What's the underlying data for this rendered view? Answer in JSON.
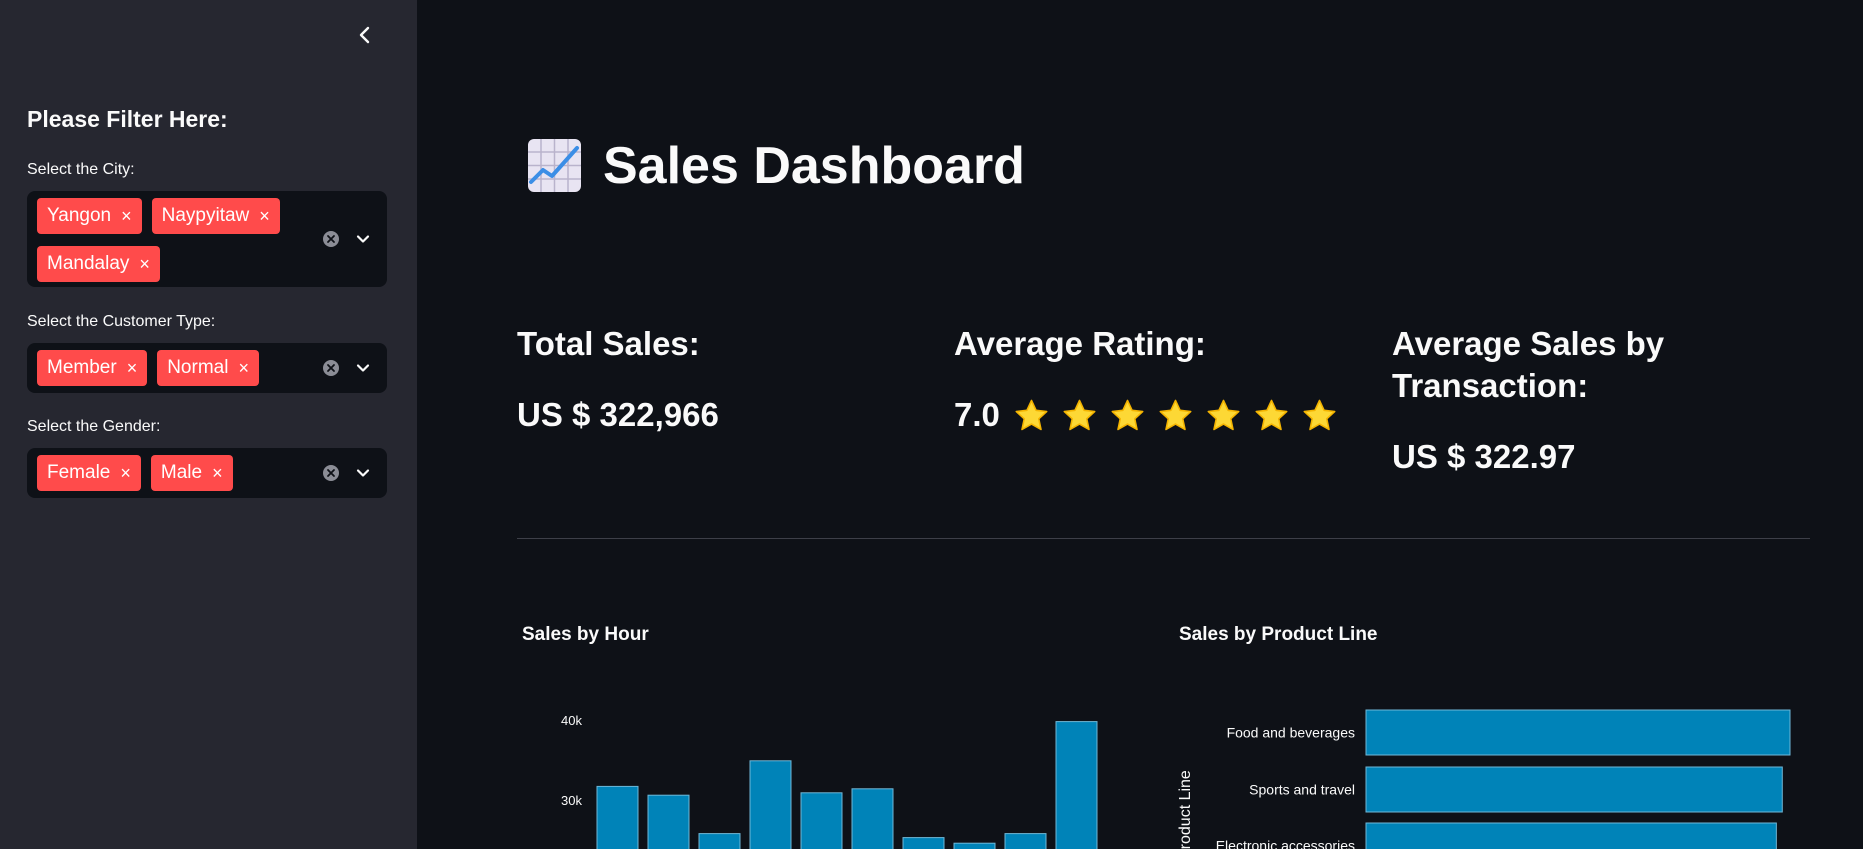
{
  "sidebar": {
    "header": "Please Filter Here:",
    "filters": [
      {
        "label": "Select the City:",
        "chips": [
          "Yangon",
          "Naypyitaw",
          "Mandalay"
        ]
      },
      {
        "label": "Select the Customer Type:",
        "chips": [
          "Member",
          "Normal"
        ]
      },
      {
        "label": "Select the Gender:",
        "chips": [
          "Female",
          "Male"
        ]
      }
    ],
    "chip_remove_glyph": "×"
  },
  "main": {
    "title": "Sales Dashboard",
    "title_icon": "chart-increasing-icon",
    "metrics": [
      {
        "title": "Total Sales:",
        "value": "US $ 322,966"
      },
      {
        "title": "Average Rating:",
        "value": "7.0",
        "stars": 7
      },
      {
        "title": "Average Sales by Transaction:",
        "value": "US $ 322.97"
      }
    ]
  },
  "colors": {
    "accent": "#ff4b4b",
    "bar": "#0083b8",
    "star": "#fdd835",
    "background": "#0e1117",
    "sidebar": "#262730"
  },
  "chart_data": [
    {
      "type": "bar",
      "title": "Sales by Hour",
      "ylim": [
        0,
        42000
      ],
      "yticks": [
        30000,
        40000
      ],
      "ytick_labels": [
        "30k",
        "40k"
      ],
      "values": [
        31700,
        30600,
        25800,
        34900,
        30900,
        31400,
        25300,
        24600,
        25800,
        39800
      ]
    },
    {
      "type": "bar",
      "orientation": "horizontal",
      "title": "Sales by Product Line",
      "ylabel": "Product Line",
      "categories": [
        "Food and beverages",
        "Sports and travel",
        "Electronic accessories"
      ],
      "values": [
        56145,
        55123,
        54338
      ]
    }
  ]
}
